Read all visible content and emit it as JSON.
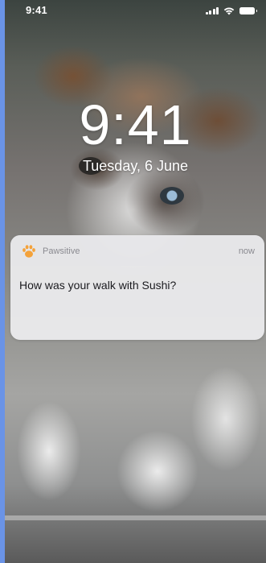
{
  "status_bar": {
    "time": "9:41",
    "icons": [
      "cellular-signal-icon",
      "wifi-icon",
      "battery-icon"
    ]
  },
  "lock_screen": {
    "clock": "9:41",
    "date": "Tuesday, 6 June"
  },
  "notification": {
    "app_icon": "paw-icon",
    "app_name": "Pawsitive",
    "time": "now",
    "message": "How was your walk with Sushi?"
  },
  "colors": {
    "accent_paw": "#f4a23a",
    "frame_accent": "#6a93e6"
  }
}
